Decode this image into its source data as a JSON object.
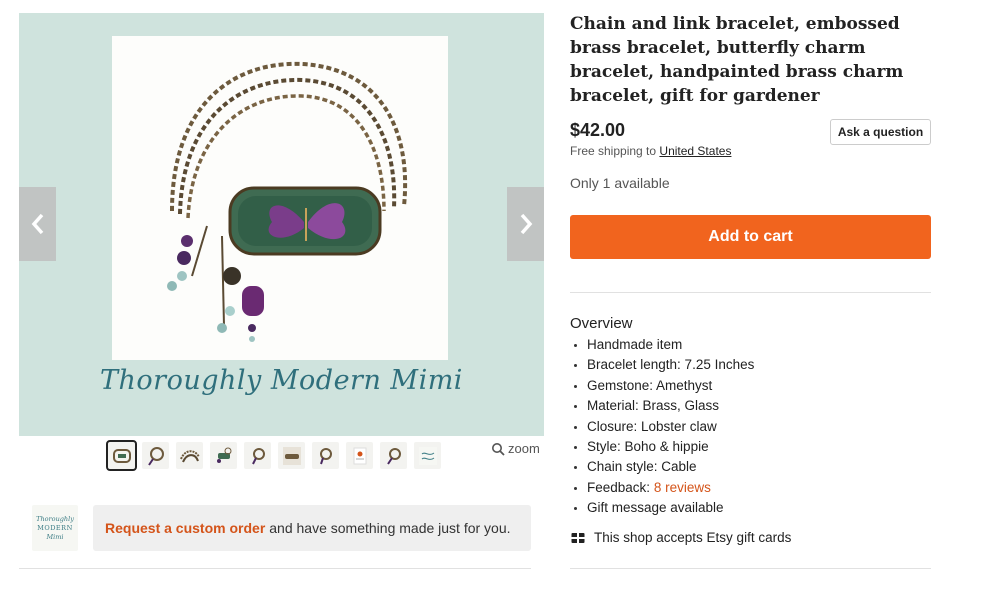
{
  "gallery": {
    "watermark": "Thoroughly Modern Mimi",
    "zoom_label": "zoom",
    "thumbnail_count": 10,
    "active_thumbnail": 1
  },
  "shop": {
    "logo_text": [
      "Thoroughly",
      "MODERN",
      "Mimi"
    ]
  },
  "custom_order": {
    "link": "Request a custom order",
    "text": "and have something made just for you."
  },
  "listing": {
    "title": "Chain and link bracelet, embossed brass bracelet, butterfly charm bracelet, handpainted brass charm bracelet, gift for gardener",
    "price": "$42.00",
    "ask_label": "Ask a question",
    "shipping_prefix": "Free shipping to",
    "shipping_dest": "United States",
    "availability": "Only 1 available",
    "add_to_cart": "Add to cart"
  },
  "overview": {
    "heading": "Overview",
    "items": [
      "Handmade item",
      "Bracelet length: 7.25 Inches",
      "Gemstone: Amethyst",
      "Material: Brass, Glass",
      "Closure: Lobster claw",
      "Style: Boho & hippie",
      "Chain style: Cable"
    ],
    "feedback_label": "Feedback:",
    "feedback_link": "8 reviews",
    "gift_message": "Gift message available"
  },
  "giftcards": {
    "text": "This shop accepts Etsy gift cards"
  },
  "colors": {
    "accent_orange": "#f1641e",
    "link_orange": "#d4541a",
    "image_bg": "#cfe3dd",
    "watermark_teal": "#2f6f7c"
  }
}
